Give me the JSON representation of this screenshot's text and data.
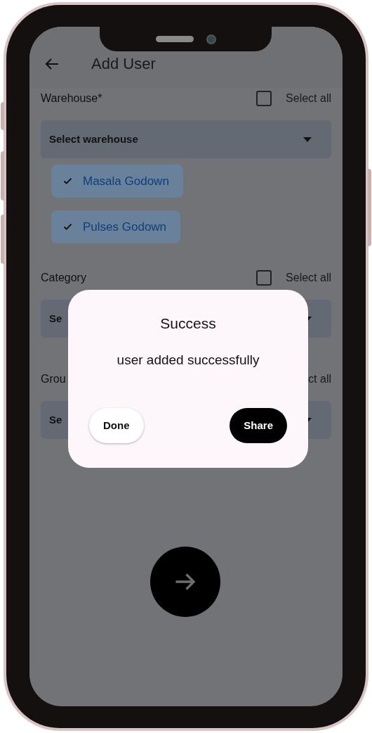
{
  "header": {
    "title": "Add User"
  },
  "sections": [
    {
      "label": "Warehouse*",
      "select_all": {
        "label": "Select all",
        "checked": false
      },
      "dropdown": "Select warehouse",
      "chips": [
        {
          "label": "Masala Godown",
          "selected": true
        },
        {
          "label": "Pulses Godown",
          "selected": true
        }
      ]
    },
    {
      "label": "Category",
      "select_all": {
        "label": "Select all",
        "checked": false
      },
      "dropdown": "Se"
    },
    {
      "label": "Grou",
      "select_all": {
        "label": "ct all"
      },
      "dropdown": "Se"
    }
  ],
  "dialog": {
    "title": "Success",
    "message": "user added successfully",
    "buttons": [
      {
        "label": "Done",
        "kind": "outline"
      },
      {
        "label": "Share",
        "kind": "filled"
      }
    ]
  }
}
